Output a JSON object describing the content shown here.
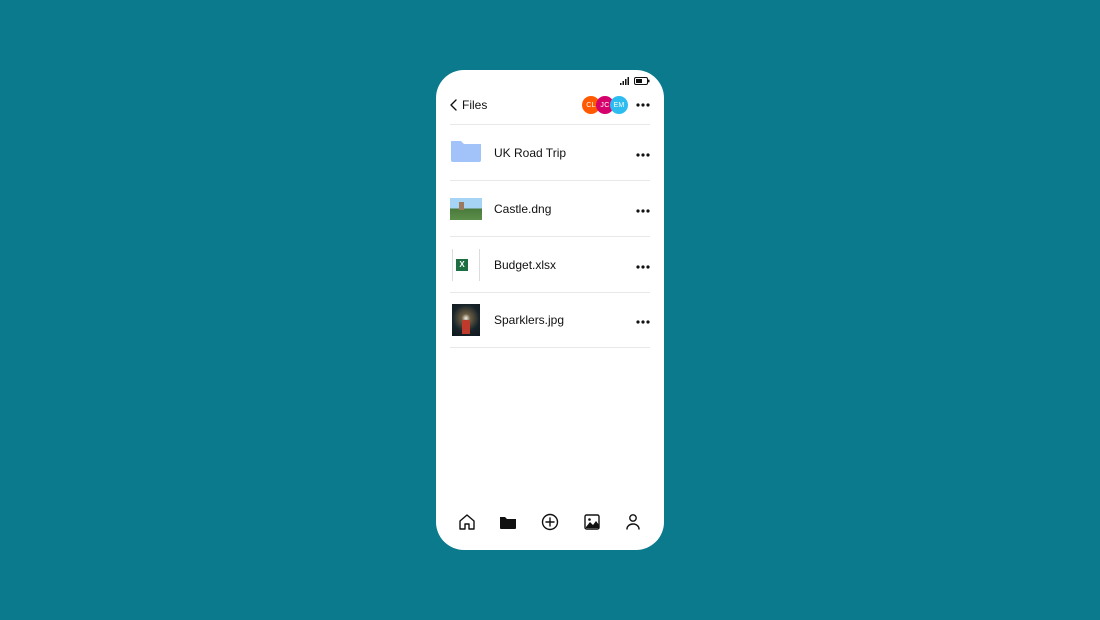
{
  "header": {
    "back_label": "Files"
  },
  "avatars": [
    {
      "initials": "CL",
      "color": "#ff5a00"
    },
    {
      "initials": "JC",
      "color": "#d6006c"
    },
    {
      "initials": "EM",
      "color": "#2dbcf0"
    }
  ],
  "files": [
    {
      "name": "UK Road Trip",
      "kind": "folder"
    },
    {
      "name": "Castle.dng",
      "kind": "image-castle"
    },
    {
      "name": "Budget.xlsx",
      "kind": "xlsx"
    },
    {
      "name": "Sparklers.jpg",
      "kind": "image-sparkler"
    }
  ],
  "nav": {
    "home": "home",
    "files": "files",
    "add": "add",
    "photos": "photos",
    "account": "account"
  }
}
